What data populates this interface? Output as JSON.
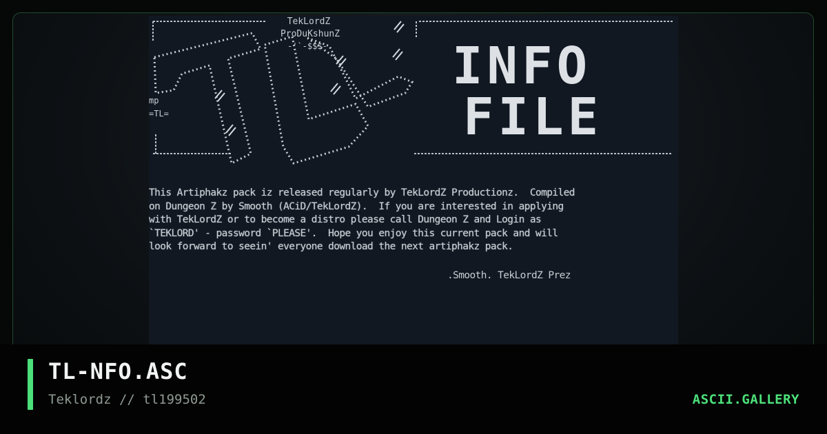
{
  "artwork": {
    "logo_caption_line1": "TekLordZ",
    "logo_caption_line2": "ProDuKshunZ",
    "logo_caption_line3": "-'`-$$$-",
    "side_tag_line1": "mp",
    "side_tag_line2": "=TL=",
    "heading_line1": "INFO",
    "heading_line2": "FILE",
    "body_lines": [
      "This Artiphakz pack iz released regularly by TekLordZ Productionz.  Compiled",
      "on Dungeon Z by Smooth (ACiD/TekLordZ).  If you are interested in applying",
      "with TekLordZ or to become a distro please call Dungeon Z and Login as",
      "`TEKLORD' - password `PLEASE'.  Hope you enjoy this current pack and will",
      "look forward to seein' everyone download the next artiphakz pack."
    ],
    "signature": ".Smooth. TekLordZ Prez"
  },
  "footer": {
    "title": "TL-NFO.ASC",
    "subtitle": "Teklordz // tl199502",
    "brand": "ASCII.GALLERY"
  },
  "colors": {
    "accent": "#4ce07a",
    "screen_bg": "#111821",
    "ansi_text": "#c9cdd3"
  }
}
